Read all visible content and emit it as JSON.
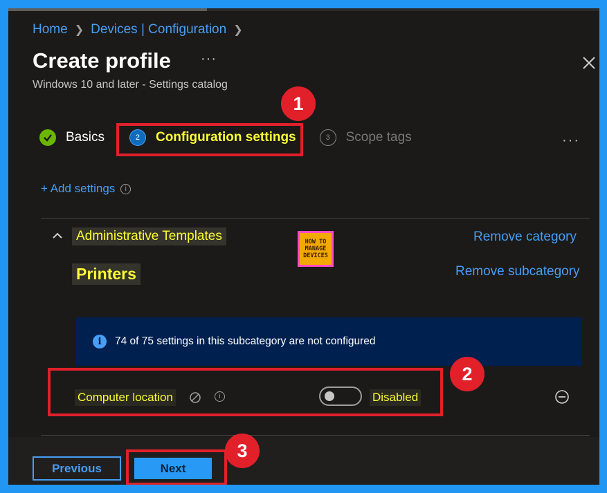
{
  "breadcrumb": {
    "home": "Home",
    "devices": "Devices | Configuration"
  },
  "header": {
    "title": "Create profile",
    "more": "···",
    "subtitle": "Windows 10 and later - Settings catalog"
  },
  "steps": [
    {
      "label": "Basics",
      "status": "complete"
    },
    {
      "number": "2",
      "label": "Configuration settings",
      "status": "active"
    },
    {
      "number": "3",
      "label": "Scope tags",
      "status": "upcoming"
    }
  ],
  "steps_more": "···",
  "add_settings": "+ Add settings",
  "category": {
    "name": "Administrative Templates",
    "remove_label": "Remove category",
    "subcategory": "Printers",
    "remove_sub_label": "Remove subcategory"
  },
  "logo": {
    "line1": "HOW TO",
    "line2": "MANAGE",
    "line3": "DEVICES"
  },
  "info_message": "74 of 75 settings in this subcategory are not configured",
  "setting": {
    "name": "Computer location",
    "state_label": "Disabled",
    "enabled": false
  },
  "footer": {
    "previous_label": "Previous",
    "next_label": "Next"
  },
  "annotations": [
    "1",
    "2",
    "3"
  ],
  "colors": {
    "frame": "#2196f3",
    "panel": "#1b1a19",
    "link": "#479ef5",
    "highlight_text": "#ffff33",
    "annotation_red": "#e2202a",
    "info_bar": "#002050"
  }
}
